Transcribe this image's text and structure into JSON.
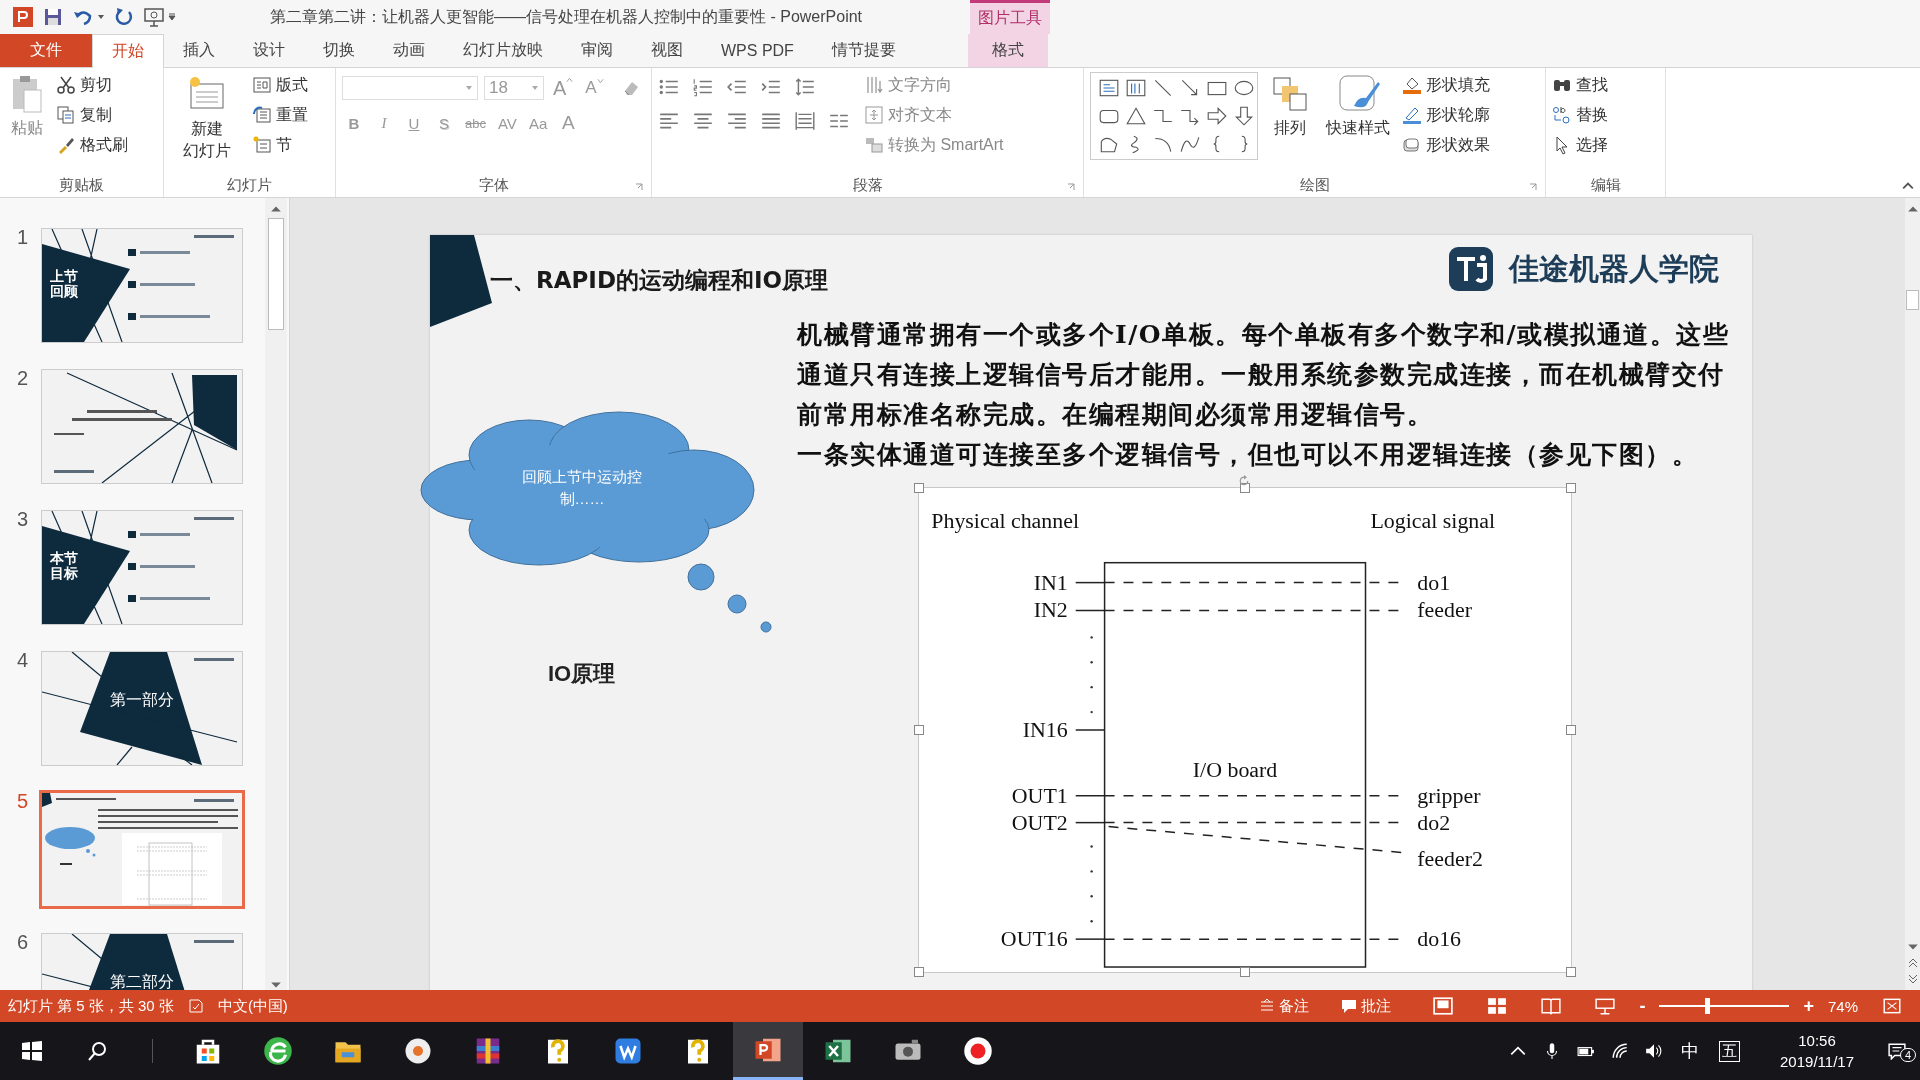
{
  "window": {
    "title": "第二章第二讲：让机器人更智能——信号处理在机器人控制中的重要性 - PowerPoint"
  },
  "contextual_group": "图片工具",
  "tabs": [
    {
      "label": "文件",
      "kind": "file",
      "selected": false
    },
    {
      "label": "开始",
      "kind": "tab",
      "selected": true
    },
    {
      "label": "插入",
      "kind": "tab",
      "selected": false
    },
    {
      "label": "设计",
      "kind": "tab",
      "selected": false
    },
    {
      "label": "切换",
      "kind": "tab",
      "selected": false
    },
    {
      "label": "动画",
      "kind": "tab",
      "selected": false
    },
    {
      "label": "幻灯片放映",
      "kind": "tab",
      "selected": false
    },
    {
      "label": "审阅",
      "kind": "tab",
      "selected": false
    },
    {
      "label": "视图",
      "kind": "tab",
      "selected": false
    },
    {
      "label": "WPS PDF",
      "kind": "tab",
      "selected": false
    },
    {
      "label": "情节提要",
      "kind": "tab",
      "selected": false
    },
    {
      "label": "格式",
      "kind": "contextual",
      "selected": false
    }
  ],
  "ribbon": {
    "clipboard": {
      "label": "剪贴板",
      "paste": "粘贴",
      "items": [
        "剪切",
        "复制",
        "格式刷"
      ]
    },
    "slides": {
      "label": "幻灯片",
      "new_slide": [
        "新建",
        "幻灯片"
      ],
      "items": [
        "版式",
        "重置",
        "节"
      ]
    },
    "font": {
      "label": "字体",
      "font_size": "18",
      "grow": "A",
      "shrink": "A",
      "styles": [
        "B",
        "I",
        "U",
        "S",
        "abc",
        "AV",
        "Aa",
        "A"
      ]
    },
    "paragraph": {
      "label": "段落",
      "items": [
        "文字方向",
        "对齐文本",
        "转换为 SmartArt"
      ]
    },
    "drawing": {
      "label": "绘图",
      "large": [
        "排列",
        "快速样式"
      ],
      "items": [
        "形状填充",
        "形状轮廓",
        "形状效果"
      ]
    },
    "editing": {
      "label": "编辑",
      "items": [
        "查找",
        "替换",
        "选择"
      ]
    }
  },
  "thumbnails": [
    {
      "number": "1",
      "kind": "agenda",
      "title": "上节回顾",
      "selected": false
    },
    {
      "number": "2",
      "kind": "cover",
      "selected": false
    },
    {
      "number": "3",
      "kind": "agenda",
      "title": "本节目标",
      "selected": false
    },
    {
      "number": "4",
      "kind": "section",
      "title": "第一部分",
      "selected": false
    },
    {
      "number": "5",
      "kind": "content",
      "selected": true
    },
    {
      "number": "6",
      "kind": "section",
      "title": "第二部分",
      "selected": false
    }
  ],
  "slide": {
    "heading": "一、RAPID的运动编程和IO原理",
    "logo": "佳途机器人学院",
    "paragraphs": [
      "机械臂通常拥有一个或多个I/O单板。每个单板有多个数字和/或模拟通道。这些通道只有连接上逻辑信号后才能用。一般用系统参数完成连接，而在机械臂交付前常用标准名称完成。在编程期间必须常用逻辑信号。",
      "一条实体通道可连接至多个逻辑信号，但也可以不用逻辑连接（参见下图）。"
    ],
    "callout": "回顾上节中运动控制……",
    "label": "IO原理",
    "diagram": {
      "left_header": "Physical channel",
      "right_header": "Logical signal",
      "board": "I/O board",
      "channels": [
        {
          "name": "IN1",
          "signals": [
            "do1"
          ]
        },
        {
          "name": "IN2",
          "signals": [
            "feeder"
          ]
        },
        {
          "name": "IN16"
        },
        {
          "name": "OUT1",
          "signals": [
            "gripper"
          ]
        },
        {
          "name": "OUT2",
          "signals": [
            "do2",
            "feeder2"
          ]
        },
        {
          "name": "OUT16",
          "signals": [
            "do16"
          ]
        }
      ]
    }
  },
  "status_bar": {
    "slide_info": "幻灯片 第 5 张，共 30 张",
    "language": "中文(中国)",
    "notes": "备注",
    "comments": "批注",
    "zoom_out": "-",
    "zoom_in": "+",
    "zoom": "74%",
    "level": 0.37
  },
  "taskbar": {
    "ime": "中",
    "ime_mode": "五",
    "time": "10:56",
    "date": "2019/11/17",
    "notifications": "4"
  }
}
